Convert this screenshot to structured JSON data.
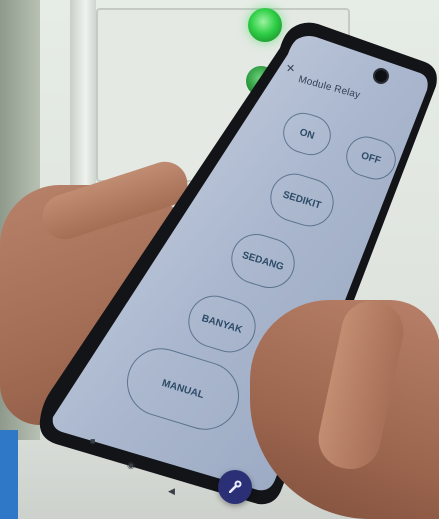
{
  "app": {
    "title": "Module Relay",
    "close_icon": "close-icon"
  },
  "controls": {
    "on_label": "ON",
    "off_label": "OFF",
    "sedikit_label": "SEDIKIT",
    "sedang_label": "SEDANG",
    "banyak_label": "BANYAK",
    "manual_label": "MANUAL"
  },
  "system_nav": {
    "recent_icon": "square-icon",
    "home_icon": "circle-icon",
    "back_icon": "triangle-icon"
  },
  "fab": {
    "icon": "wrench-icon"
  },
  "colors": {
    "screen_bg": "#aebbd2",
    "button_border": "#1e3c5a",
    "button_text": "#2d4a66",
    "fab_bg": "#2b2f75",
    "status_lamp": "#2fcf46"
  }
}
